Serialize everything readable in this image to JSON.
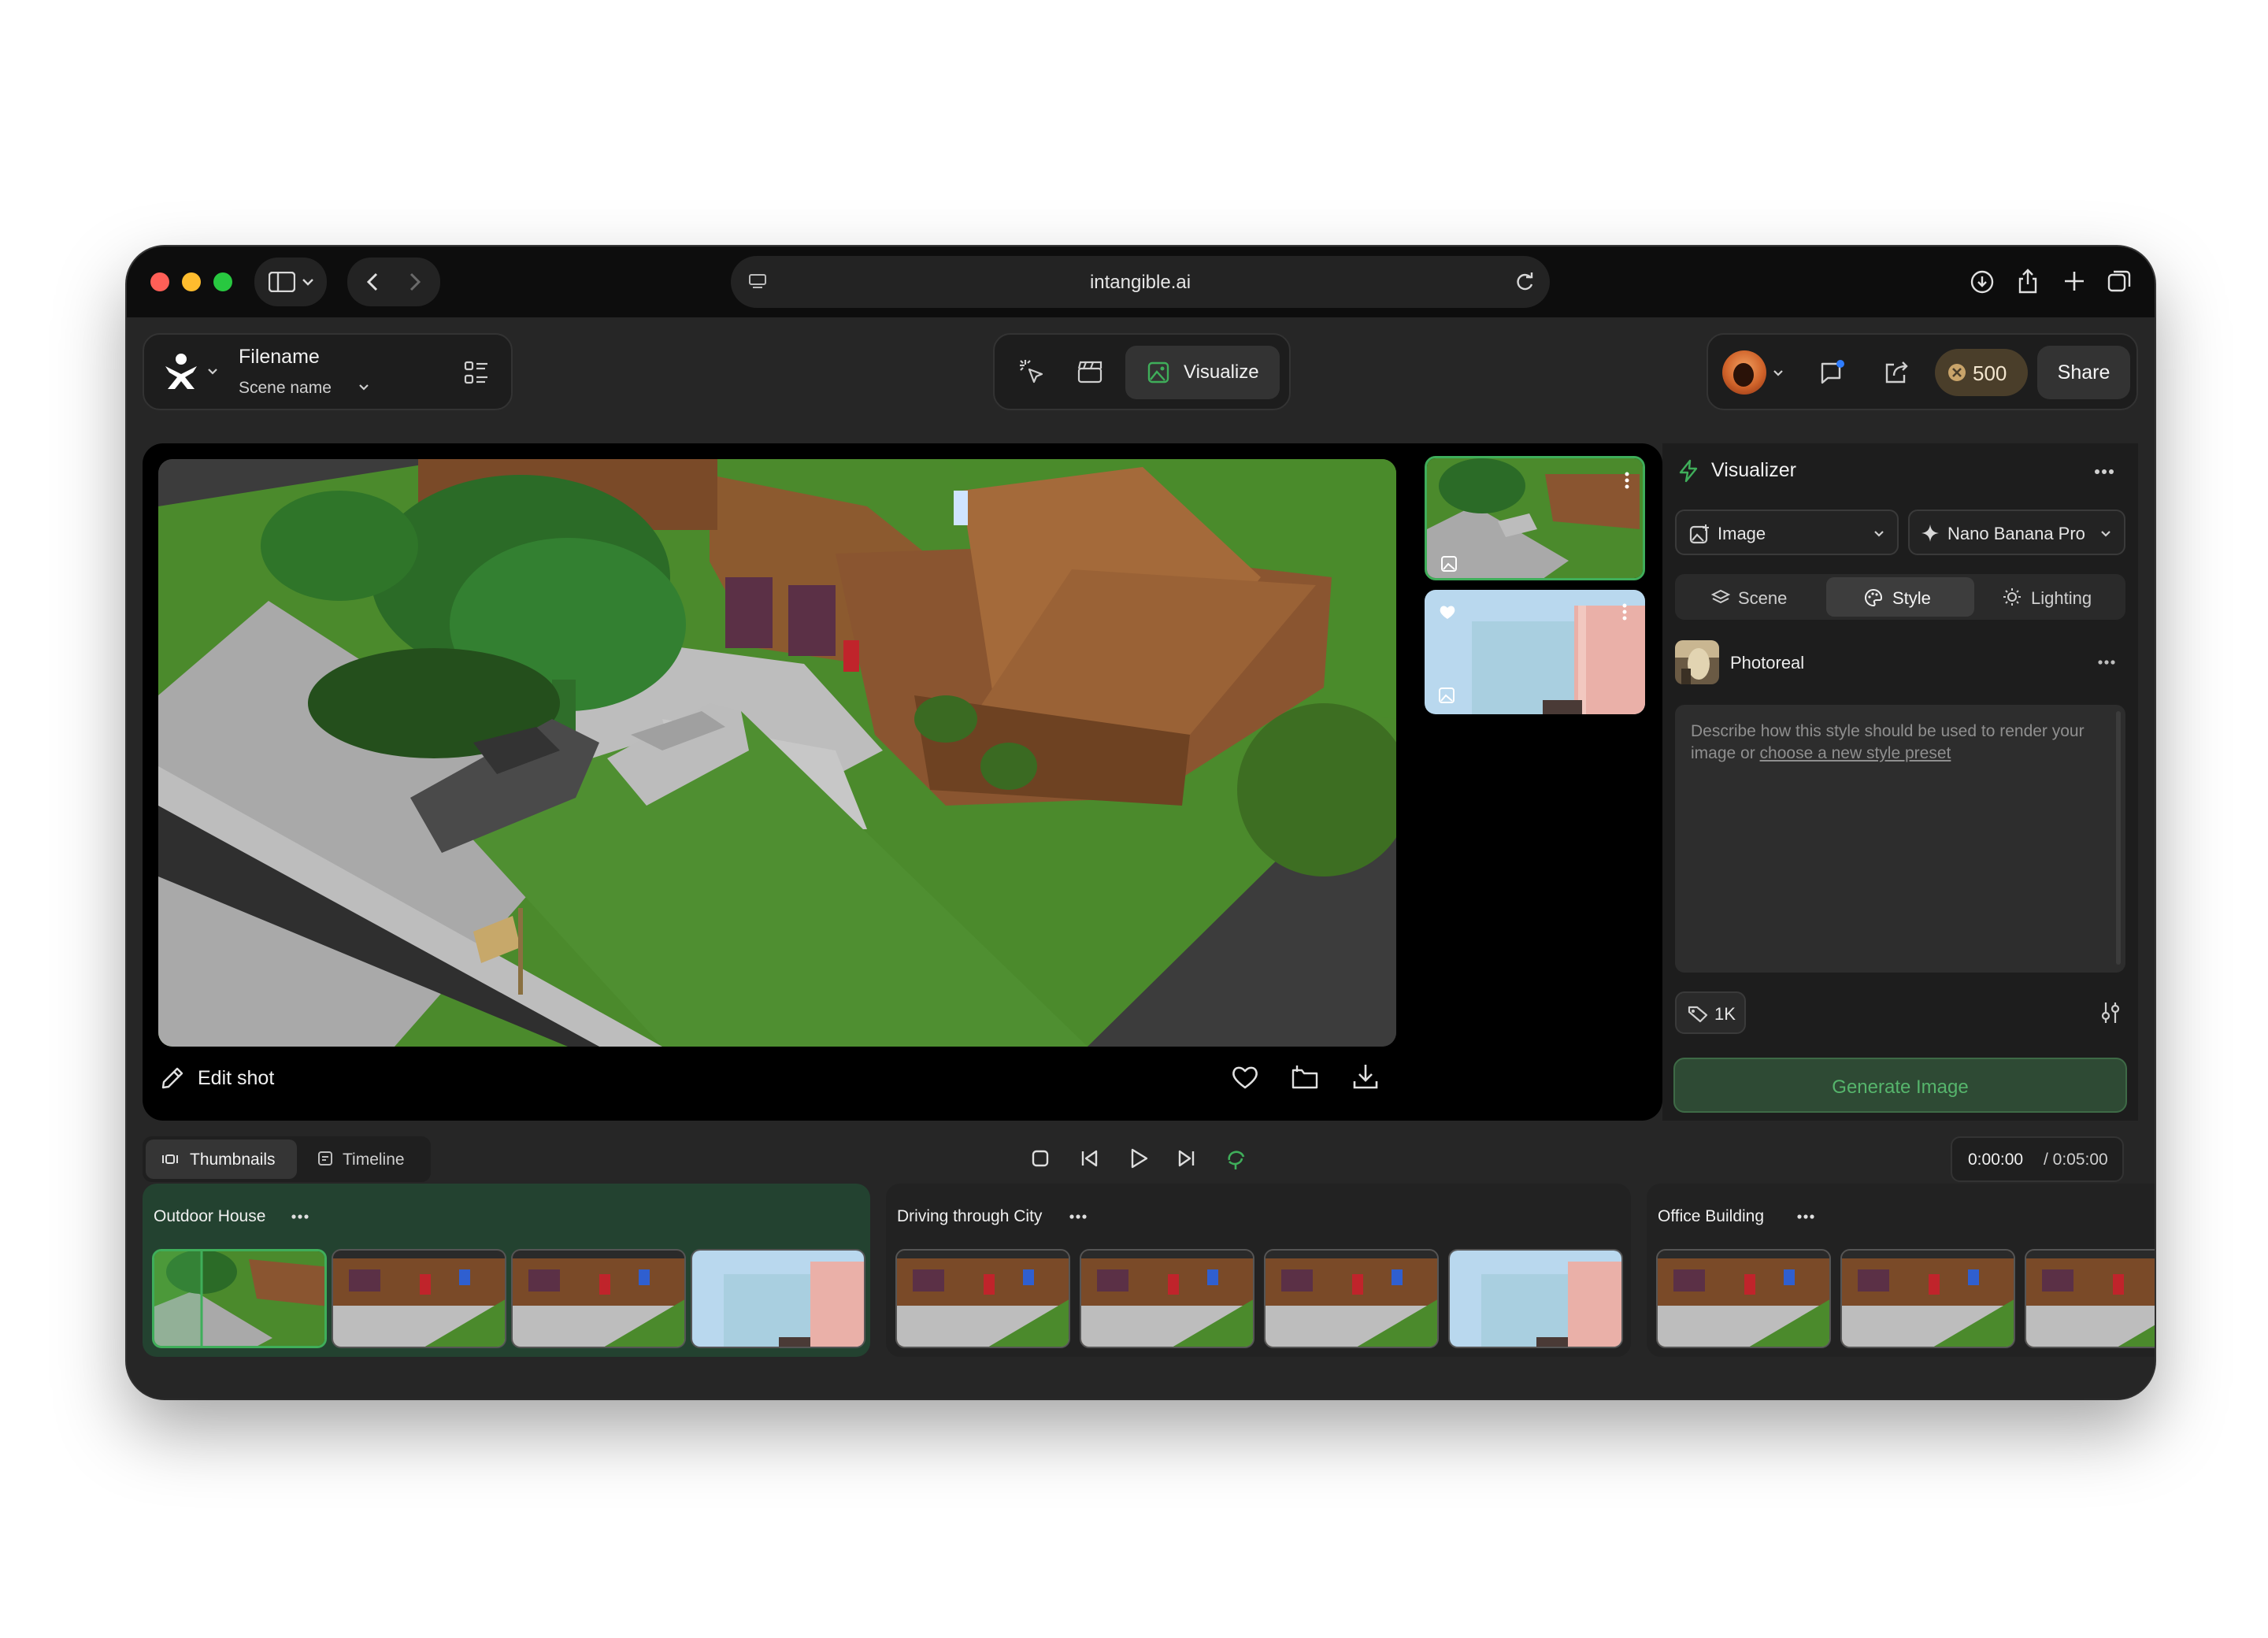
{
  "browser": {
    "url": "intangible.ai",
    "traffic_colors": [
      "#ff5f57",
      "#febc2e",
      "#28c840"
    ]
  },
  "header": {
    "filename": "Filename",
    "scene_name": "Scene name",
    "modes": {
      "visualize_label": "Visualize"
    },
    "credits": "500",
    "share_label": "Share"
  },
  "viewer": {
    "edit_shot_label": "Edit shot"
  },
  "visualizer": {
    "title": "Visualizer",
    "output_type": "Image",
    "model": "Nano Banana Pro",
    "tabs": [
      "Scene",
      "Style",
      "Lighting"
    ],
    "active_tab": "Style",
    "style_preset": "Photoreal",
    "prompt_placeholder_prefix": "Describe how this style should be used to render your image or ",
    "prompt_link": "choose a new style preset",
    "resolution": "1K",
    "generate_label": "Generate Image",
    "accent": "#3fae5a"
  },
  "timeline": {
    "tabs": [
      "Thumbnails",
      "Timeline"
    ],
    "active_tab": "Thumbnails",
    "current_time": "0:00:00",
    "total_time": "/ 0:05:00",
    "scenes": [
      {
        "name": "Outdoor House"
      },
      {
        "name": "Driving through City"
      },
      {
        "name": "Office Building"
      }
    ]
  }
}
